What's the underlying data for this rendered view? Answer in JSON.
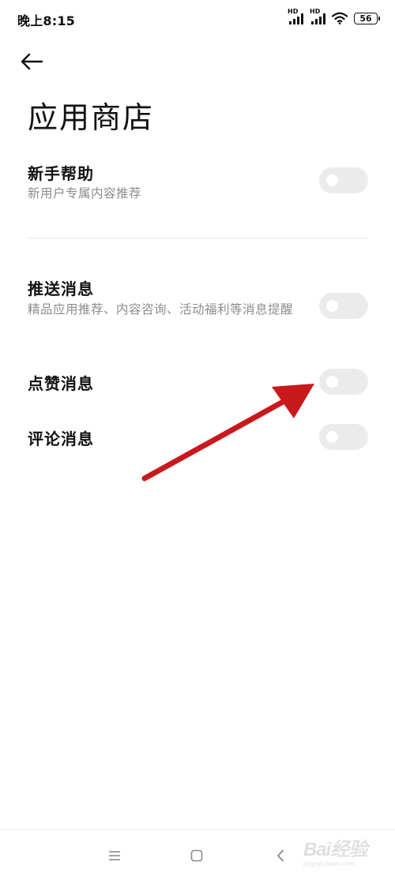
{
  "status_bar": {
    "time": "晚上8:15",
    "signal_label_1": "HD",
    "signal_label_2": "HD",
    "battery_level": "56",
    "icons": [
      "hd-signal-icon",
      "hd-signal-icon",
      "wifi-icon",
      "battery-icon"
    ]
  },
  "header": {
    "back_icon": "back-arrow-icon",
    "title": "应用商店"
  },
  "settings": [
    {
      "title": "新手帮助",
      "description": "新用户专属内容推荐",
      "enabled": false
    },
    {
      "title": "推送消息",
      "description": "精品应用推荐、内容咨询、活动福利等消息提醒",
      "enabled": false
    },
    {
      "title": "点赞消息",
      "description": "",
      "enabled": false
    },
    {
      "title": "评论消息",
      "description": "",
      "enabled": false
    }
  ],
  "nav_bar": {
    "icons": [
      "menu-icon",
      "home-icon",
      "back-icon"
    ]
  },
  "watermark": {
    "text": "Bai经验",
    "url": "jingyan.baidu.com"
  },
  "colors": {
    "toggle_off": "#ebebeb",
    "description_text": "#8c8c8c",
    "annotation_arrow": "#c8191c"
  }
}
